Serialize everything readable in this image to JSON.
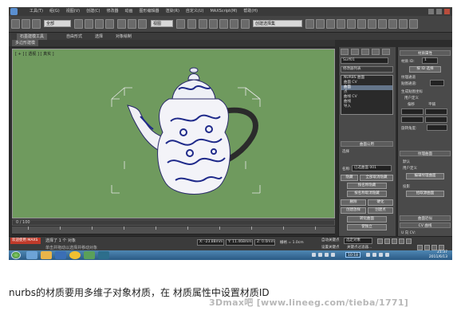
{
  "titlebar": {
    "menu": [
      "工具(T)",
      "组(G)",
      "视图(V)",
      "创建(C)",
      "修改器",
      "动画",
      "图形编辑器",
      "渲染(R)",
      "自定义(U)",
      "MAXScript(M)",
      "帮助(H)"
    ],
    "title": "Autodesk 3ds Max  2011 x64     nurbs_teapot.max"
  },
  "toolbar": {
    "select_filter": "全部",
    "view_select": "视图",
    "named_sel": "创建选择集"
  },
  "ribbon": {
    "tabs": [
      "石墨建模工具",
      "自由形式",
      "选择",
      "对象绘制"
    ],
    "sub_tab": "多边形建模"
  },
  "viewport": {
    "label": "[ + ] [ 透视 ] [ 真实 ]"
  },
  "cmd_panel": {
    "name_field": "Surf01",
    "modifier_list": "修改器列表",
    "stack": [
      "NURBS 曲面",
      "曲面 CV",
      "曲面",
      "点",
      "曲线 CV",
      "曲线",
      "导入"
    ],
    "rollout_general": "曲面公用",
    "sel_label": "选择",
    "name_label": "名称:",
    "name_value": "已选曲面 001",
    "hide_btn": "隐藏",
    "unhide_btn": "全部取消隐藏",
    "hide_by_name": "按名称隐藏",
    "unhide_by_name": "按名称取消隐藏",
    "delete_btn": "删除",
    "break_btn": "硬化",
    "create_rigid": "创建放样",
    "create_pts": "创建点",
    "convert_surface": "转化曲面",
    "make_independent": "使独立"
  },
  "mat_panel": {
    "title": "材质属性",
    "mat_id_label": "材质 ID:",
    "mat_id_value": "1",
    "select_by_id": "按 ID 选择",
    "tex_channel": "纹理通道",
    "channel_label": "贴图通道:",
    "gen_mapping": "生成贴图坐标",
    "user_defined": "用户定义",
    "offset": "偏移",
    "tiling": "平铺",
    "rotation": "旋转角度:",
    "texture_surface": "纹理曲面",
    "default": "默认",
    "user_defined2": "用户定义",
    "projected": "投影",
    "pick_source": "拾取源曲面",
    "edit_texture": "编辑纹理曲面",
    "surface_approx": "曲面近似",
    "cv_curve": "CV 曲线",
    "u_label": "U 向 CV:"
  },
  "timeline": {
    "frame": "0 / 100"
  },
  "status": {
    "welcome": "欢迎使用 MAXS",
    "selected": "选择了 1 个 对象",
    "hint": "单击并拖动以选择并移动对象",
    "x": "X: -23.88mm",
    "y": "Y: 11.468mm",
    "z": "Z: 0.0mm",
    "grid": "栅格 = 1.0cm",
    "autokey": "自动关键点",
    "sel_set": "选定对象",
    "setkey": "设置关键点",
    "keyfilter": "关键点过滤器..."
  },
  "taskbar": {
    "time": "21:37",
    "date": "2011/6/13",
    "tray_badge": "10:18"
  },
  "caption": "nurbs的材质要用多维子对象材质，在 材质属性中设置材质ID",
  "watermark": "3Dmax吧 [www.lineeg.com/tieba/1771]"
}
